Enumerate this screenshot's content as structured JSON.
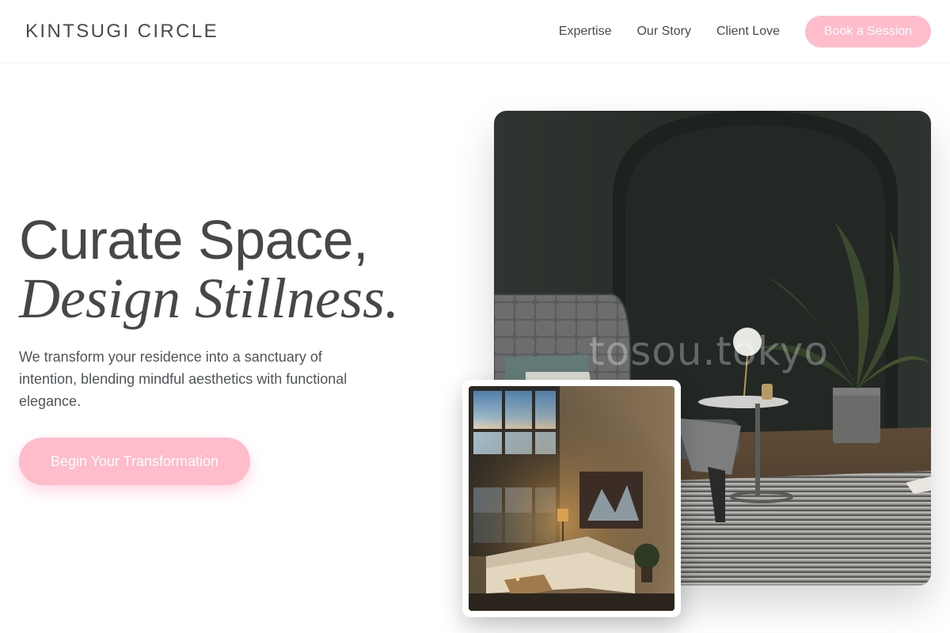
{
  "brand": {
    "name": "KINTSUGI CIRCLE"
  },
  "nav": {
    "links": [
      "Expertise",
      "Our Story",
      "Client Love"
    ],
    "cta_label": "Book a Session"
  },
  "hero": {
    "title_line1": "Curate Space,",
    "title_line2": "Design Stillness.",
    "description": "We transform your residence into a sanctuary of intention, blending mindful aesthetics with functional elegance.",
    "cta_label": "Begin Your Transformation"
  },
  "images": {
    "main_watermark": "tosou.tokyo"
  },
  "colors": {
    "accent_pink": "#ffbccb",
    "text_dark": "#474747",
    "text_muted": "#4f5558"
  }
}
